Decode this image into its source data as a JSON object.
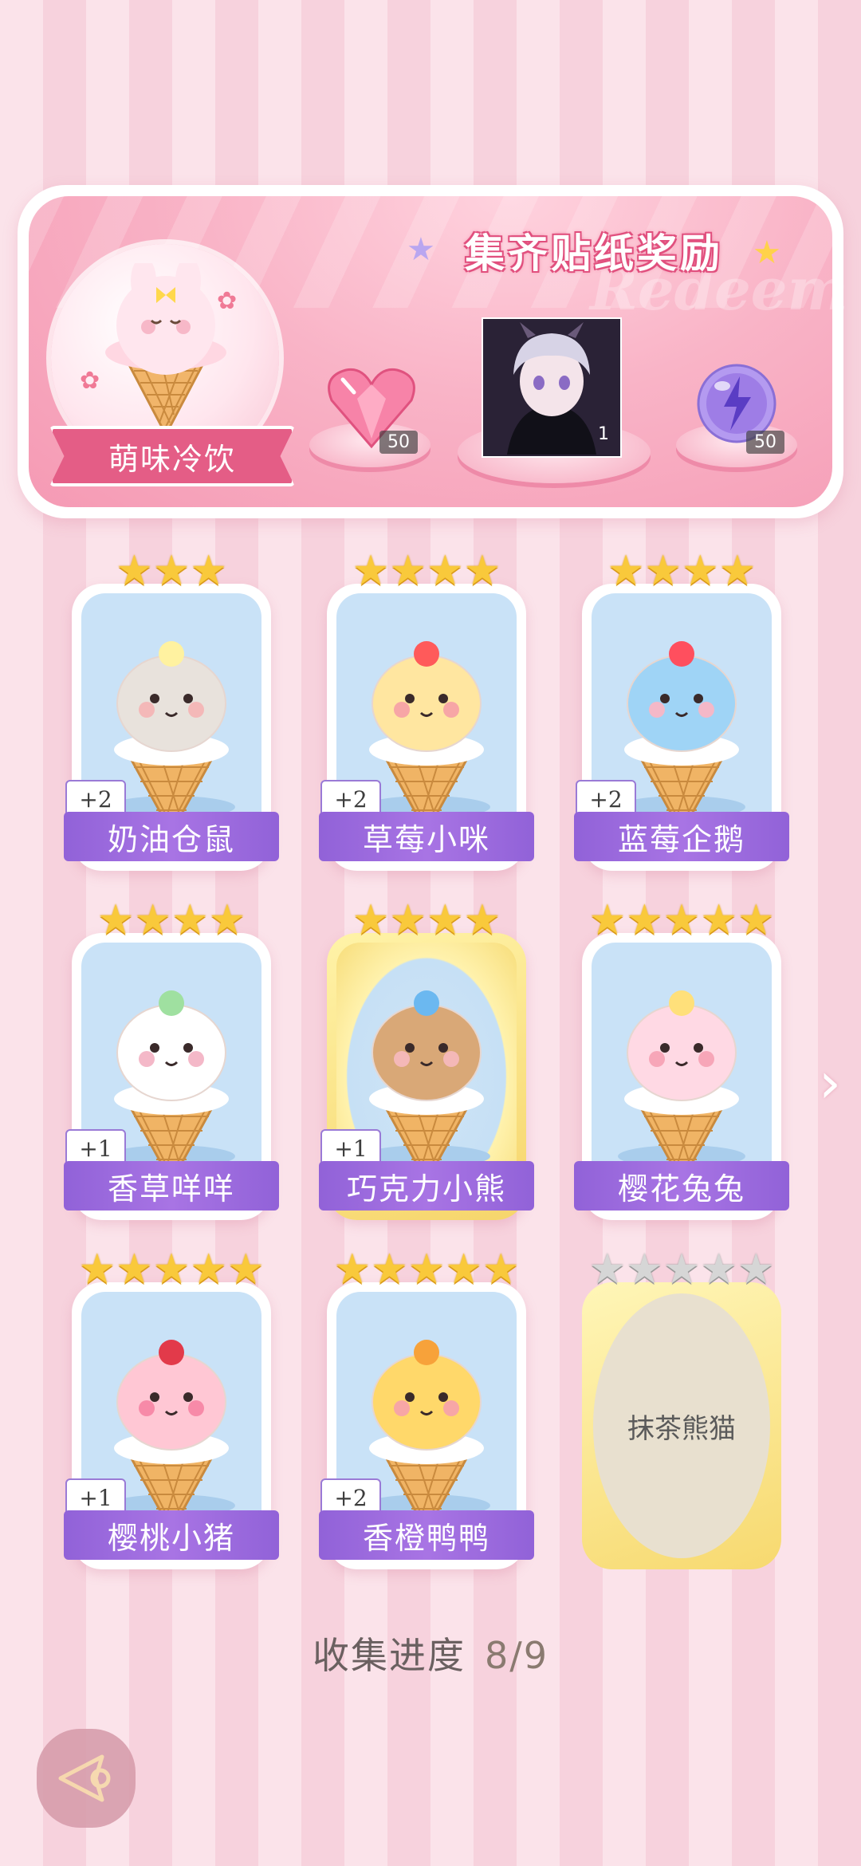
{
  "banner": {
    "title": "集齐贴纸奖励",
    "watermark": "Redeem",
    "category_label": "萌味冷饮",
    "rewards": [
      {
        "icon": "pink-heart-gem-icon",
        "count": "50"
      },
      {
        "icon": "character-portrait",
        "count": "1"
      },
      {
        "icon": "purple-energy-orb-icon",
        "count": "50"
      }
    ]
  },
  "cards": [
    {
      "name": "奶油仓鼠",
      "stars": 3,
      "bonus": "+2",
      "collected": true,
      "rare": false
    },
    {
      "name": "草莓小咪",
      "stars": 4,
      "bonus": "+2",
      "collected": true,
      "rare": false
    },
    {
      "name": "蓝莓企鹅",
      "stars": 4,
      "bonus": "+2",
      "collected": true,
      "rare": false
    },
    {
      "name": "香草咩咩",
      "stars": 4,
      "bonus": "+1",
      "collected": true,
      "rare": false
    },
    {
      "name": "巧克力小熊",
      "stars": 4,
      "bonus": "+1",
      "collected": true,
      "rare": true
    },
    {
      "name": "樱花兔兔",
      "stars": 5,
      "bonus": "",
      "collected": true,
      "rare": false
    },
    {
      "name": "樱桃小猪",
      "stars": 5,
      "bonus": "+1",
      "collected": true,
      "rare": false
    },
    {
      "name": "香橙鸭鸭",
      "stars": 5,
      "bonus": "+2",
      "collected": true,
      "rare": false
    },
    {
      "name": "抹茶熊猫",
      "stars": 5,
      "bonus": "",
      "collected": false,
      "rare": true
    }
  ],
  "progress": {
    "label": "收集进度",
    "value": "8/9"
  },
  "colors": {
    "accent_pink": "#e45d86",
    "name_bar_purple": "#9162d8",
    "star_gold": "#f9c93b"
  }
}
